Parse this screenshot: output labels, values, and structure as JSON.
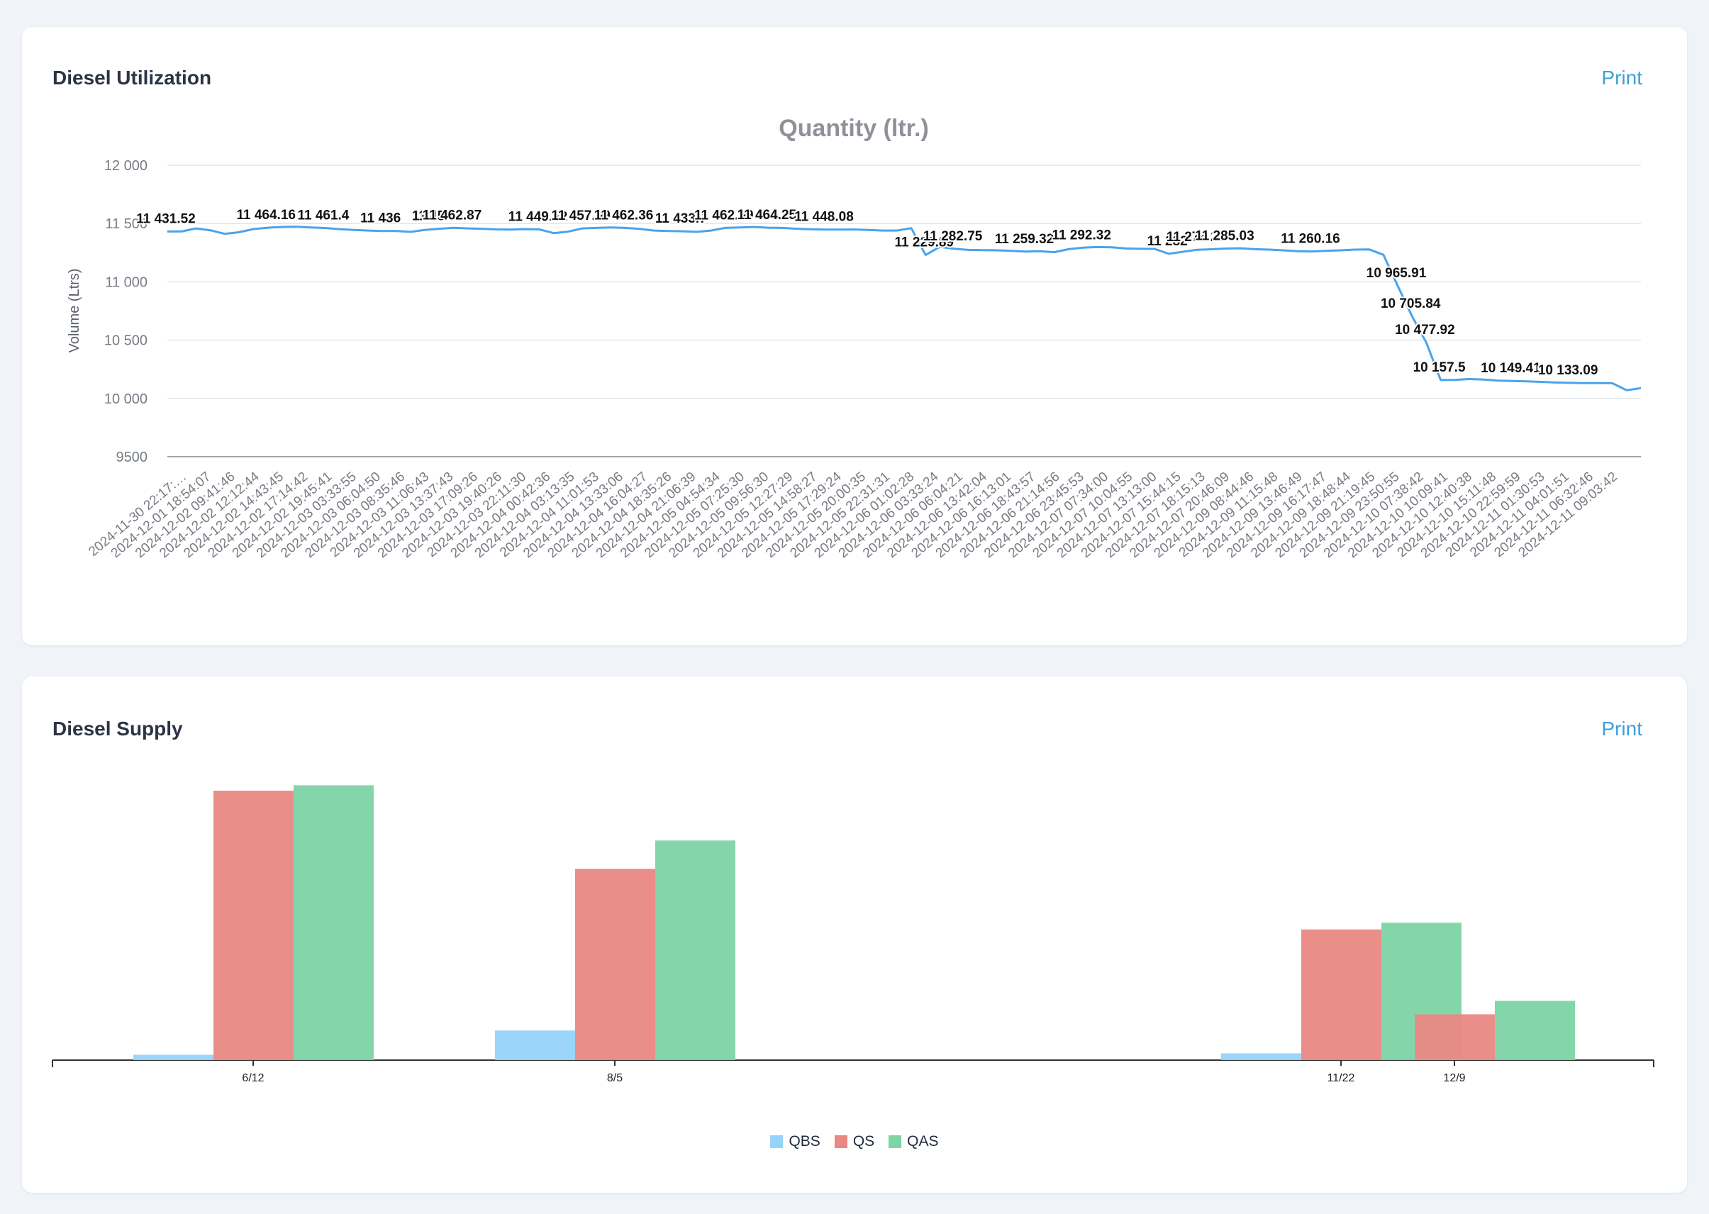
{
  "cards": {
    "utilization": {
      "title": "Diesel Utilization",
      "print_label": "Print"
    },
    "supply": {
      "title": "Diesel Supply",
      "print_label": "Print"
    }
  },
  "colors": {
    "line": "#4aa3ec",
    "qbs": "#96d3f8",
    "qs": "#e98884",
    "qas": "#7dd4a5",
    "grid": "#e3e6eb",
    "axis": "#a0a4aa"
  },
  "chart_data": [
    {
      "type": "line",
      "title": "Quantity (ltr.)",
      "ylabel": "Volume (Ltrs)",
      "xlabel": "",
      "ylim": [
        9500,
        12000
      ],
      "yticks": [
        9500,
        10000,
        10500,
        11000,
        11500,
        12000
      ],
      "ytick_labels": [
        "9500",
        "10 000",
        "10 500",
        "11 000",
        "11 500",
        "12 000"
      ],
      "grid": true,
      "x_labels": [
        "2024-11-30 22:17:…",
        "2024-12-01 18:54:07",
        "2024-12-02 09:41:46",
        "2024-12-02 12:12:44",
        "2024-12-02 14:43:45",
        "2024-12-02 17:14:42",
        "2024-12-02 19:45:41",
        "2024-12-03 03:33:55",
        "2024-12-03 06:04:50",
        "2024-12-03 08:35:46",
        "2024-12-03 11:06:43",
        "2024-12-03 13:37:43",
        "2024-12-03 17:09:26",
        "2024-12-03 19:40:26",
        "2024-12-03 22:11:30",
        "2024-12-04 00:42:36",
        "2024-12-04 03:13:35",
        "2024-12-04 11:01:53",
        "2024-12-04 13:33:06",
        "2024-12-04 16:04:27",
        "2024-12-04 18:35:26",
        "2024-12-04 21:06:39",
        "2024-12-05 04:54:34",
        "2024-12-05 07:25:30",
        "2024-12-05 09:56:30",
        "2024-12-05 12:27:29",
        "2024-12-05 14:58:27",
        "2024-12-05 17:29:24",
        "2024-12-05 20:00:35",
        "2024-12-05 22:31:31",
        "2024-12-06 01:02:28",
        "2024-12-06 03:33:24",
        "2024-12-06 06:04:21",
        "2024-12-06 13:42:04",
        "2024-12-06 16:13:01",
        "2024-12-06 18:43:57",
        "2024-12-06 21:14:56",
        "2024-12-06 23:45:53",
        "2024-12-07 07:34:00",
        "2024-12-07 10:04:55",
        "2024-12-07 13:13:00",
        "2024-12-07 15:44:15",
        "2024-12-07 18:15:13",
        "2024-12-07 20:46:09",
        "2024-12-09 08:44:46",
        "2024-12-09 11:15:48",
        "2024-12-09 13:46:49",
        "2024-12-09 16:17:47",
        "2024-12-09 18:48:44",
        "2024-12-09 21:19:45",
        "2024-12-09 23:50:55",
        "2024-12-10 07:38:42",
        "2024-12-10 10:09:41",
        "2024-12-10 12:40:38",
        "2024-12-10 15:11:48",
        "2024-12-10 22:59:59",
        "2024-12-11 01:30:53",
        "2024-12-11 04:01:51",
        "2024-12-11 06:32:46",
        "2024-12-11 09:03:42"
      ],
      "series": [
        {
          "values": [
            11431.52,
            11432,
            11458,
            11442,
            11412,
            11425,
            11452,
            11464.16,
            11470,
            11472,
            11466,
            11461.4,
            11452,
            11445,
            11440,
            11436,
            11436,
            11428,
            11445,
            11454.8,
            11462.87,
            11458,
            11455,
            11449.22,
            11448,
            11452,
            11449.22,
            11418,
            11430,
            11457.99,
            11462,
            11466,
            11462.36,
            11454,
            11440,
            11436,
            11433.7,
            11428,
            11440,
            11462.09,
            11466,
            11470,
            11464.25,
            11462,
            11455,
            11450,
            11448.08,
            11448,
            11449,
            11445,
            11440,
            11440,
            11460,
            11229.89,
            11300,
            11282.75,
            11274,
            11272,
            11270,
            11266,
            11259.32,
            11262,
            11254,
            11280,
            11292.32,
            11298,
            11296,
            11286,
            11283,
            11282,
            11240,
            11258,
            11275.21,
            11279,
            11285.03,
            11288,
            11280,
            11276,
            11270,
            11262,
            11260.16,
            11265,
            11270,
            11276,
            11278,
            11232,
            10965.91,
            10705.84,
            10477.92,
            10157.5,
            10159,
            10166,
            10162,
            10152,
            10149.41,
            10146,
            10142,
            10136,
            10133.09,
            10131,
            10131,
            10130,
            10070,
            10088
          ]
        }
      ],
      "data_labels": [
        {
          "i": 0,
          "text": "11 431.52"
        },
        {
          "i": 7,
          "text": "11 464.16"
        },
        {
          "i": 11,
          "text": "11 461.4"
        },
        {
          "i": 15,
          "text": "11 436"
        },
        {
          "i": 19,
          "text": "11 454.8"
        },
        {
          "i": 20,
          "text": "11 462.87"
        },
        {
          "i": 26,
          "text": "11 449.22"
        },
        {
          "i": 29,
          "text": "11 457.99"
        },
        {
          "i": 32,
          "text": "11 462.36"
        },
        {
          "i": 36,
          "text": "11 433.7"
        },
        {
          "i": 39,
          "text": "11 462.09"
        },
        {
          "i": 42,
          "text": "11 464.25"
        },
        {
          "i": 46,
          "text": "11 448.08"
        },
        {
          "i": 53,
          "text": "11 229.89"
        },
        {
          "i": 55,
          "text": "11 282.75"
        },
        {
          "i": 60,
          "text": "11 259.32"
        },
        {
          "i": 64,
          "text": "11 292.32"
        },
        {
          "i": 70,
          "text": "11 282"
        },
        {
          "i": 72,
          "text": "11 275.21"
        },
        {
          "i": 74,
          "text": "11 285.03"
        },
        {
          "i": 80,
          "text": "11 260.16"
        },
        {
          "i": 86,
          "text": "10 965.91"
        },
        {
          "i": 87,
          "text": "10 705.84"
        },
        {
          "i": 88,
          "text": "10 477.92"
        },
        {
          "i": 89,
          "text": "10 157.5"
        },
        {
          "i": 94,
          "text": "10 149.41"
        },
        {
          "i": 98,
          "text": "10 133.09"
        }
      ]
    },
    {
      "type": "bar",
      "title": "",
      "x_tick_labels": [
        "6/12",
        "8/5",
        "11/22",
        "12/9"
      ],
      "ylim": [
        0,
        100
      ],
      "legend": "bottom-center",
      "series": [
        {
          "name": "QBS",
          "values": [
            2,
            11,
            2.5,
            0
          ]
        },
        {
          "name": "QS",
          "values": [
            100,
            71,
            48.5,
            17
          ]
        },
        {
          "name": "QAS",
          "values": [
            102,
            81.5,
            51,
            22
          ]
        }
      ]
    }
  ]
}
